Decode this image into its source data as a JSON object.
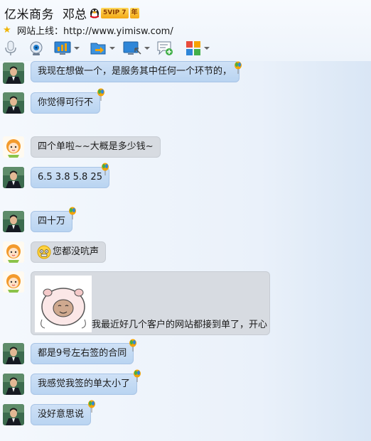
{
  "header": {
    "title": "亿米商务",
    "name": "邓总",
    "vip_label": "5VIP 7",
    "year_label": "年",
    "site_label": "网站上线：http://www.yimisw.com/"
  },
  "toolbar": {
    "icons": [
      "microphone-icon",
      "video-icon",
      "screen-share-icon",
      "file-transfer-icon",
      "remote-desktop-icon",
      "sms-icon",
      "apps-icon"
    ]
  },
  "messages": [
    {
      "sender": "me",
      "text": "我现在想做一个，是服务其中任何一个环节的，"
    },
    {
      "sender": "me",
      "text": "你觉得可行不"
    },
    {
      "sender": "them",
      "text": "四个单啦~~大概是多少钱~"
    },
    {
      "sender": "me",
      "text": "6.5 3.8 5.8 25"
    },
    {
      "sender": "me",
      "text": "四十万"
    },
    {
      "sender": "them",
      "text": "您都没吭声"
    },
    {
      "sender": "them",
      "text": "我最近好几个客户的网站都接到单了，开心"
    },
    {
      "sender": "me",
      "text": "都是9号左右签的合同"
    },
    {
      "sender": "me",
      "text": "我感觉我签的单太小了"
    },
    {
      "sender": "me",
      "text": "没好意思说"
    }
  ],
  "colors": {
    "me_bubble": "#c4daf4",
    "them_bubble": "#d7dbe1",
    "background": "#eaf1fa"
  }
}
